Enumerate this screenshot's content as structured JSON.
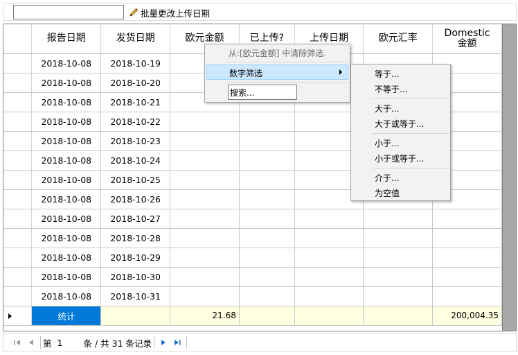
{
  "toolbar": {
    "date_value": "",
    "batch_button_label": "批量更改上传日期"
  },
  "grid": {
    "columns": [
      "报告日期",
      "发货日期",
      "欧元金额",
      "已上传?",
      "上传日期",
      "欧元汇率",
      "Domestic\n金额"
    ],
    "rows": [
      [
        "2018-10-08",
        "2018-10-19"
      ],
      [
        "2018-10-08",
        "2018-10-20"
      ],
      [
        "2018-10-08",
        "2018-10-21"
      ],
      [
        "2018-10-08",
        "2018-10-22"
      ],
      [
        "2018-10-08",
        "2018-10-23"
      ],
      [
        "2018-10-08",
        "2018-10-24"
      ],
      [
        "2018-10-08",
        "2018-10-25"
      ],
      [
        "2018-10-08",
        "2018-10-26"
      ],
      [
        "2018-10-08",
        "2018-10-27"
      ],
      [
        "2018-10-08",
        "2018-10-28"
      ],
      [
        "2018-10-08",
        "2018-10-29"
      ],
      [
        "2018-10-08",
        "2018-10-30"
      ],
      [
        "2018-10-08",
        "2018-10-31"
      ]
    ],
    "summary": {
      "label": "统计",
      "eur_amount": "21.68",
      "domestic_amount": "200,004.35"
    }
  },
  "pager": {
    "prefix": "第",
    "page": "1",
    "suffix": "条 / 共 31 条记录"
  },
  "context_menu": {
    "clear_filter": "从:[欧元金额] 中清除筛选.",
    "number_filter": "数字筛选",
    "search": "搜索..."
  },
  "submenu": {
    "equals": "等于...",
    "not_equals": "不等于...",
    "greater": "大于...",
    "greater_equal": "大于或等于...",
    "less": "小于...",
    "less_equal": "小于或等于...",
    "between": "介于...",
    "is_null": "为空值"
  },
  "colors": {
    "selection": "#0078d7",
    "summary_bg": "#ffffe1",
    "menu_hover": "#cce8ff",
    "scrollbar": "#a9a9a9"
  }
}
